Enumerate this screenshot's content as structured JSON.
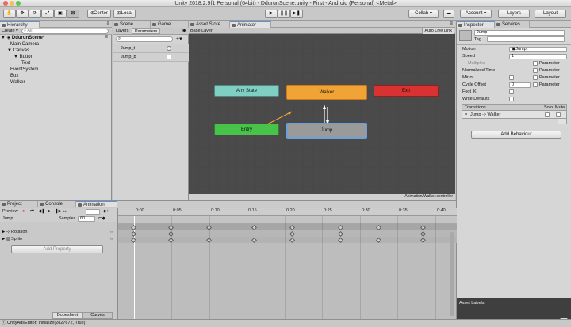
{
  "window": {
    "title": "Unity 2018.2.9f1 Personal (64bit) - DdurunScene.unity - First - Android (Personal) <Metal>"
  },
  "toolbar": {
    "pivot_label": "Center",
    "space_label": "Local",
    "collab_label": "Collab ▾",
    "account_label": "Account ▾",
    "layers_label": "Layers",
    "layout_label": "Layout"
  },
  "hierarchy": {
    "tab_label": "Hierarchy",
    "create_label": "Create ▾",
    "search_placeholder": "All",
    "scene_label": "DdurunScene*",
    "items": [
      "Main Camera",
      "Canvas",
      "Button",
      "Text",
      "EventSystem",
      "Box",
      "Walker"
    ]
  },
  "center_tabs": {
    "scene": "Scene",
    "game": "Game",
    "asset_store": "Asset Store",
    "animator": "Animator"
  },
  "animator": {
    "layers_tab": "Layers",
    "parameters_tab": "Parameters",
    "base_layer": "Base Layer",
    "auto_live_link": "Auto Live Link",
    "parameters": [
      {
        "name": "Jump_t"
      },
      {
        "name": "Jump_b"
      }
    ],
    "states": {
      "any": "Any State",
      "entry": "Entry",
      "walker": "Walker",
      "exit": "Exit",
      "jump": "Jump"
    },
    "footer_path": "Animation/Walker.controller"
  },
  "colors": {
    "any_state": "#7fd0c3",
    "entry": "#47c349",
    "walker": "#f1a435",
    "exit": "#d93232",
    "jump": "#9a9a9a",
    "graph_bg": "#4a4a4a"
  },
  "inspector": {
    "tab_label": "Inspector",
    "services_label": "Services",
    "name_value": "Jump",
    "tag_label": "Tag",
    "motion_label": "Motion",
    "motion_value": "Jump",
    "speed_label": "Speed",
    "speed_value": "1",
    "multiplier_label": "Multiplier",
    "parameter_label": "Parameter",
    "normalized_time_label": "Normalized Time",
    "mirror_label": "Mirror",
    "cycle_offset_label": "Cycle Offset",
    "cycle_offset_value": "0",
    "foot_ik_label": "Foot IK",
    "write_defaults_label": "Write Defaults",
    "transitions_label": "Transitions",
    "solo_label": "Solo",
    "mute_label": "Mute",
    "transition_item": "Jump -> Walker",
    "add_behaviour_label": "Add Behaviour",
    "asset_labels_label": "Asset Labels"
  },
  "bottom": {
    "project_tab": "Project",
    "console_tab": "Console",
    "animation_tab": "Animation",
    "preview_label": "Preview",
    "clip_name": "Jump",
    "samples_label": "Samples",
    "samples_value": "60",
    "properties": [
      {
        "name": "Rotation"
      },
      {
        "name": "Sprite"
      }
    ],
    "add_property_label": "Add Property",
    "dopesheet_label": "Dopesheet",
    "curves_label": "Curves",
    "time_ticks": [
      "0:00",
      "0:05",
      "0:10",
      "0:15",
      "0:20",
      "0:25",
      "0:30",
      "0:35",
      "0:40"
    ]
  },
  "statusbar": {
    "text": "UnityAdsEditor: Initialize(2827672, True);"
  }
}
